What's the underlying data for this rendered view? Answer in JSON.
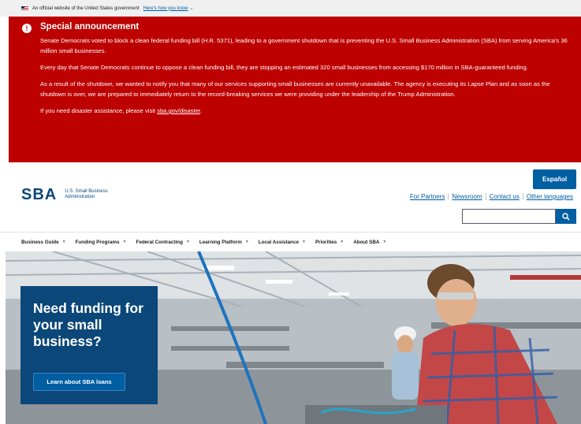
{
  "gov_banner": {
    "text": "An official website of the United States government",
    "link": "Here's how you know",
    "icon": "chevron-down-icon"
  },
  "alert": {
    "icon": "exclamation-circle-icon",
    "title": "Special announcement",
    "paragraphs": [
      "Senate Democrats voted to block a clean federal funding bill (H.R. 5371), leading to a government shutdown that is preventing the U.S. Small Business Administration (SBA) from serving America's 36 million small businesses.",
      "Every day that Senate Democrats continue to oppose a clean funding bill, they are stopping an estimated 320 small businesses from accessing $170 million in SBA-guaranteed funding.",
      "As a result of the shutdown, we wanted to notify you that many of our services supporting small businesses are currently unavailable. The agency is executing its Lapse Plan and as soon as the shutdown is over, we are prepared to immediately return to the record-breaking services we were providing under the leadership of the Trump Administration."
    ],
    "disaster_prefix": "If you need disaster assistance, please visit ",
    "disaster_link": "sba.gov/disaster",
    "disaster_suffix": "."
  },
  "header": {
    "logo_mark": "SBA",
    "logo_text": "U.S. Small Business Administration",
    "espanol": "Español",
    "links": [
      "For Partners",
      "Newsroom",
      "Contact us",
      "Other languages"
    ],
    "search_icon": "search-icon"
  },
  "nav": {
    "items": [
      "Business Guide",
      "Funding Programs",
      "Federal Contracting",
      "Learning Platform",
      "Local Assistance",
      "Priorities",
      "About SBA"
    ]
  },
  "hero": {
    "heading": "Need funding for your small business?",
    "button": "Learn about SBA loans"
  },
  "colors": {
    "alert_red": "#bd0000",
    "brand_blue": "#0b4778",
    "link_blue": "#005ea2"
  }
}
